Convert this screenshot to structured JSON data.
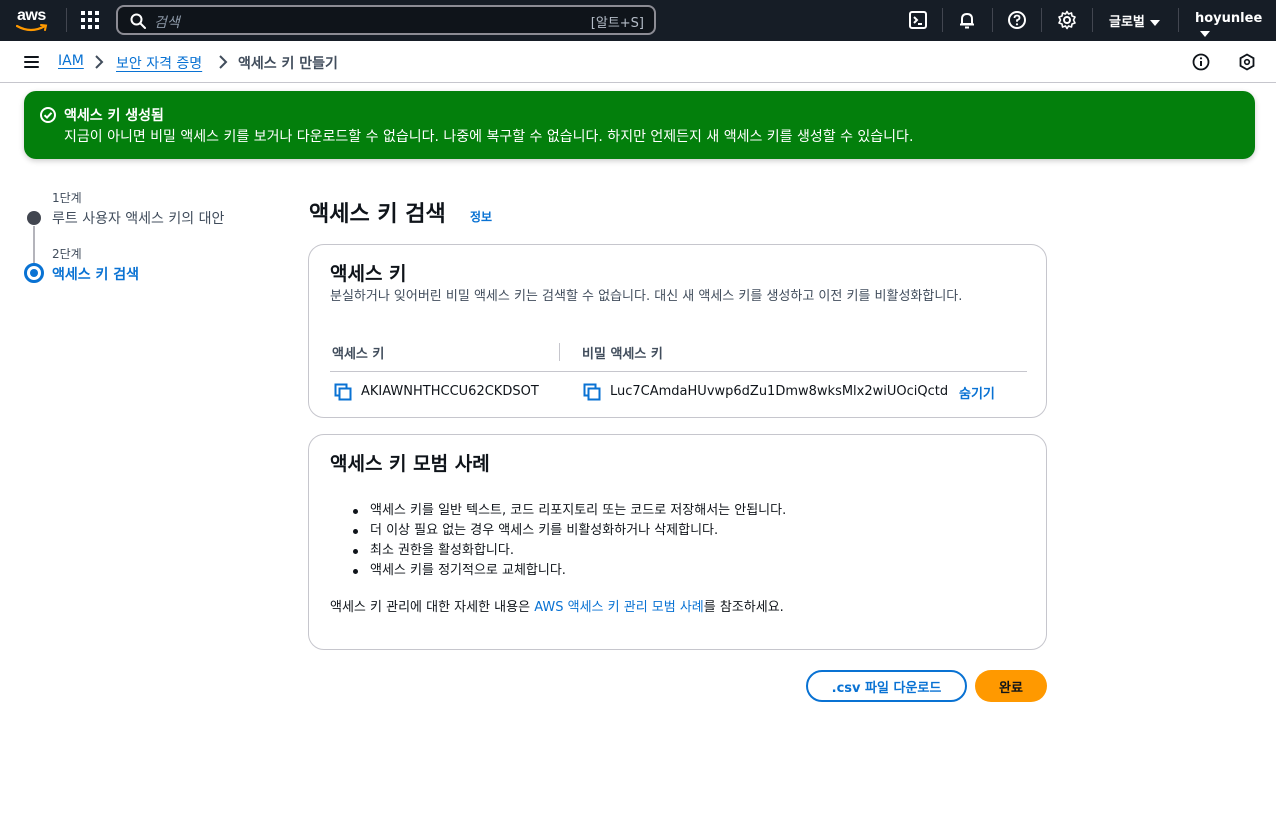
{
  "topbar": {
    "logo": "aws",
    "search_placeholder": "검색",
    "search_shortcut": "[알트+S]",
    "region": "글로벌",
    "user": "hoyunlee",
    "icons": [
      "cloudshell-icon",
      "bell-icon",
      "help-icon",
      "gear-icon"
    ]
  },
  "breadcrumb": {
    "items": [
      "IAM",
      "보안 자격 증명",
      "액세스 키 만들기"
    ]
  },
  "flash": {
    "title": "액세스 키 생성됨",
    "message": "지금이 아니면 비밀 액세스 키를 보거나 다운로드할 수 없습니다. 나중에 복구할 수 없습니다. 하지만 언제든지 새 액세스 키를 생성할 수 있습니다.",
    "color": "#037f0c"
  },
  "steps": [
    {
      "label": "1단계",
      "title": "루트 사용자 액세스 키의 대안"
    },
    {
      "label": "2단계",
      "title": "액세스 키 검색"
    }
  ],
  "main": {
    "heading": "액세스 키 검색",
    "info": "정보",
    "access_key_card": {
      "title": "액세스 키",
      "description": "분실하거나 잊어버린 비밀 액세스 키는 검색할 수 없습니다. 대신 새 액세스 키를 생성하고 이전 키를 비활성화합니다.",
      "col_access_key": "액세스 키",
      "col_secret_key": "비밀 액세스 키",
      "access_key": "AKIAWNHTHCCU62CKDSOT",
      "secret_key": "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",
      "hide": "숨기기"
    },
    "best_practices_card": {
      "title": "액세스 키 모범 사례",
      "bullets": [
        "액세스 키를 일반 텍스트, 코드 리포지토리 또는 코드로 저장해서는 안됩니다.",
        "더 이상 필요 없는 경우 액세스 키를 비활성화하거나 삭제합니다.",
        "최소 권한을 활성화합니다.",
        "액세스 키를 정기적으로 교체합니다."
      ],
      "more_prefix": "액세스 키 관리에 대한 자세한 내용은 ",
      "more_link": "AWS 액세스 키 관리 모범 사례",
      "more_suffix": "를 참조하세요."
    }
  },
  "actions": {
    "download_csv": ".csv 파일 다운로드",
    "done": "완료",
    "done_color": "#ff9900"
  }
}
